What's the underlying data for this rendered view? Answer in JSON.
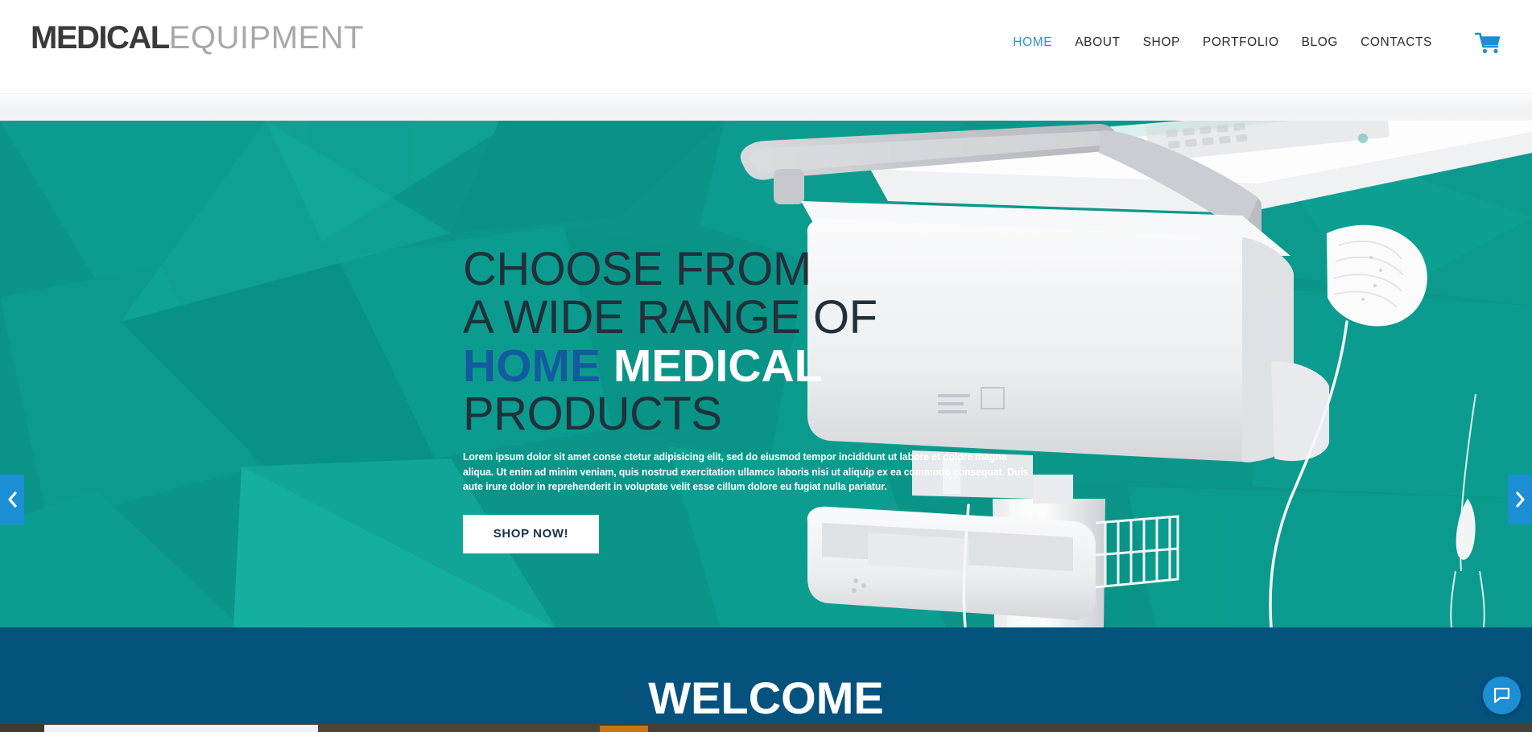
{
  "header": {
    "logo": {
      "bold": "MEDICAL",
      "thin": "EQUIPMENT"
    },
    "nav": [
      {
        "label": "HOME",
        "active": true
      },
      {
        "label": "ABOUT",
        "active": false
      },
      {
        "label": "SHOP",
        "active": false
      },
      {
        "label": "PORTFOLIO",
        "active": false
      },
      {
        "label": "BLOG",
        "active": false
      },
      {
        "label": "CONTACTS",
        "active": false
      }
    ],
    "cart_icon": "shopping-cart-icon",
    "accent_color": "#2e90d2"
  },
  "hero": {
    "headline_line1": "CHOOSE FROM",
    "headline_line2": "A WIDE RANGE OF",
    "headline_home": "HOME",
    "headline_medical": "MEDICAL",
    "headline_line4": "PRODUCTS",
    "paragraph": "Lorem ipsum dolor sit amet conse ctetur adipisicing elit, sed do eiusmod tempor incididunt ut labore et dolore magna aliqua. Ut enim ad minim veniam, quis nostrud exercitation ullamco laboris nisi ut aliquip ex ea commodo consequat. Duis aute irure dolor in reprehenderit in voluptate velit esse cillum dolore eu fugiat nulla pariatur.",
    "button_label": "SHOP NOW!",
    "prev_icon": "chevron-left-icon",
    "next_icon": "chevron-right-icon",
    "background_color": "#0b9589",
    "home_color": "#145a9e",
    "arrow_color": "#1c8ed4",
    "image_alt": "medical-equipment-cart"
  },
  "welcome": {
    "title": "WELCOME",
    "background_color": "#05527f"
  },
  "chat": {
    "icon": "chat-bubble-icon",
    "color": "#1c8ed4"
  }
}
